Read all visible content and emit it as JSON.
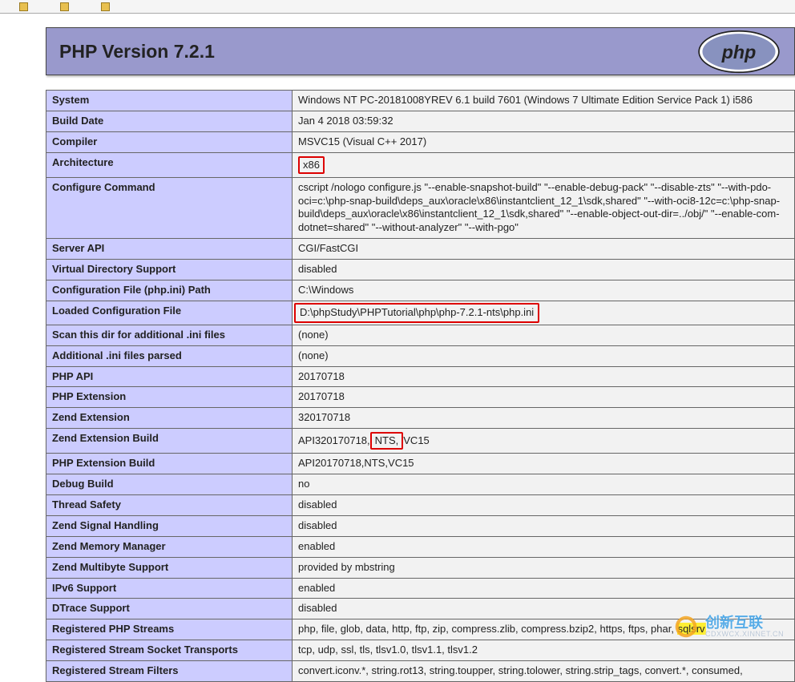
{
  "header": {
    "title": "PHP Version 7.2.1"
  },
  "rows": [
    {
      "k": "System",
      "v": "Windows NT PC-20181008YREV 6.1 build 7601 (Windows 7 Ultimate Edition Service Pack 1) i586"
    },
    {
      "k": "Build Date",
      "v": "Jan 4 2018 03:59:32"
    },
    {
      "k": "Compiler",
      "v": "MSVC15 (Visual C++ 2017)"
    },
    {
      "k": "Architecture",
      "v": "x86",
      "box": "v"
    },
    {
      "k": "Configure Command",
      "v": "cscript /nologo configure.js \"--enable-snapshot-build\" \"--enable-debug-pack\" \"--disable-zts\" \"--with-pdo-oci=c:\\php-snap-build\\deps_aux\\oracle\\x86\\instantclient_12_1\\sdk,shared\" \"--with-oci8-12c=c:\\php-snap-build\\deps_aux\\oracle\\x86\\instantclient_12_1\\sdk,shared\" \"--enable-object-out-dir=../obj/\" \"--enable-com-dotnet=shared\" \"--without-analyzer\" \"--with-pgo\""
    },
    {
      "k": "Server API",
      "v": "CGI/FastCGI"
    },
    {
      "k": "Virtual Directory Support",
      "v": "disabled"
    },
    {
      "k": "Configuration File (php.ini) Path",
      "v": "C:\\Windows"
    },
    {
      "k": "Loaded Configuration File",
      "v": "D:\\phpStudy\\PHPTutorial\\php\\php-7.2.1-nts\\php.ini",
      "box": "row"
    },
    {
      "k": "Scan this dir for additional .ini files",
      "v": "(none)"
    },
    {
      "k": "Additional .ini files parsed",
      "v": "(none)"
    },
    {
      "k": "PHP API",
      "v": "20170718"
    },
    {
      "k": "PHP Extension",
      "v": "20170718"
    },
    {
      "k": "Zend Extension",
      "v": "320170718"
    },
    {
      "k": "Zend Extension Build",
      "v_pre": "API320170718,",
      "v_box": "NTS,",
      "v_post": "VC15"
    },
    {
      "k": "PHP Extension Build",
      "v": "API20170718,NTS,VC15"
    },
    {
      "k": "Debug Build",
      "v": "no"
    },
    {
      "k": "Thread Safety",
      "v": "disabled"
    },
    {
      "k": "Zend Signal Handling",
      "v": "disabled"
    },
    {
      "k": "Zend Memory Manager",
      "v": "enabled"
    },
    {
      "k": "Zend Multibyte Support",
      "v": "provided by mbstring"
    },
    {
      "k": "IPv6 Support",
      "v": "enabled"
    },
    {
      "k": "DTrace Support",
      "v": "disabled"
    },
    {
      "k": "Registered PHP Streams",
      "v_pre": "php, file, glob, data, http, ftp, zip, compress.zlib, compress.bzip2, https, ftps, phar, ",
      "v_hl": "sqlsrv"
    },
    {
      "k": "Registered Stream Socket Transports",
      "v": "tcp, udp, ssl, tls, tlsv1.0, tlsv1.1, tlsv1.2"
    },
    {
      "k": "Registered Stream Filters",
      "v": "convert.iconv.*, string.rot13, string.toupper, string.tolower, string.strip_tags, convert.*, consumed,"
    }
  ],
  "watermark": {
    "brand": "创新互联",
    "sub": "CDXWCX.XINNET.CN"
  }
}
